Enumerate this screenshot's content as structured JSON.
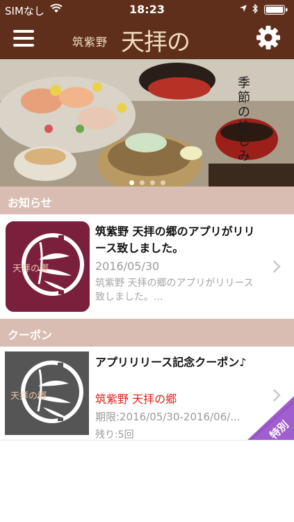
{
  "status_bar": {
    "carrier": "SIMなし",
    "time": "18:23"
  },
  "header": {
    "logo_small": "筑紫野",
    "logo_main": "天拝の郷"
  },
  "hero": {
    "caption": "季節の愉しみ",
    "slide_count": 4,
    "active_slide": 0
  },
  "notices": {
    "section_label": "お知らせ",
    "item": {
      "title": "筑紫野 天拝の郷のアプリがリリース致しました。",
      "date": "2016/05/30",
      "body": "筑紫野 天拝の郷のアプリがリリース致しました。..."
    }
  },
  "coupons": {
    "section_label": "クーポン",
    "item": {
      "title": "アプリリリース記念クーポン♪",
      "shop": "筑紫野 天拝の郷",
      "period": "期限:2016/05/30-2016/06/...",
      "remaining": "残り:5回",
      "badge": "特別"
    }
  },
  "colors": {
    "header_bg": "#5f2f1b",
    "section_bg": "#d9bdb2",
    "accent_red": "#d8241a",
    "badge_purple": "#a05fcf"
  }
}
